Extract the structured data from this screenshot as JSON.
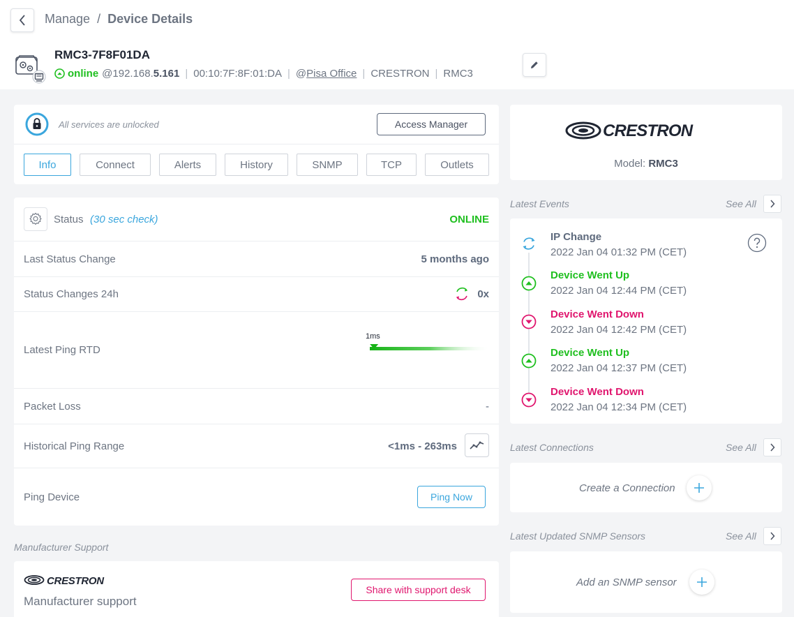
{
  "breadcrumb": {
    "parent": "Manage",
    "separator": "/",
    "current": "Device Details"
  },
  "device": {
    "name": "RMC3-7F8F01DA",
    "status": "online",
    "ip_prefix": "@192.168.",
    "ip_bold": "5.161",
    "mac": "00:10:7F:8F:01:DA",
    "location_prefix": "@",
    "location": "Pisa Office",
    "vendor": "CRESTRON",
    "model": "RMC3"
  },
  "access": {
    "text": "All services are unlocked",
    "button": "Access Manager"
  },
  "tabs": [
    "Info",
    "Connect",
    "Alerts",
    "History",
    "SNMP",
    "TCP",
    "Outlets"
  ],
  "status": {
    "label": "Status",
    "check": "(30 sec check)",
    "value": "ONLINE",
    "last_change_label": "Last Status Change",
    "last_change_value": "5 months ago",
    "changes_label": "Status Changes 24h",
    "changes_value": "0x",
    "ping_label": "Latest Ping RTD",
    "ping_value": "1ms",
    "ping_fraction": 0.02,
    "loss_label": "Packet Loss",
    "loss_value": "-",
    "range_label": "Historical Ping Range",
    "range_value": "<1ms - 263ms",
    "ping_device_label": "Ping Device",
    "ping_now": "Ping Now"
  },
  "manufacturer": {
    "section": "Manufacturer Support",
    "logo": "CRESTRON",
    "text": "Manufacturer support",
    "share": "Share with support desk"
  },
  "vendor_card": {
    "logo": "CRESTRON",
    "model_label": "Model:",
    "model": "RMC3"
  },
  "events": {
    "title": "Latest Events",
    "see_all": "See All",
    "items": [
      {
        "title": "IP Change",
        "time": "2022 Jan 04 01:32 PM (CET)",
        "type": "ip-change"
      },
      {
        "title": "Device Went Up",
        "time": "2022 Jan 04 12:44 PM (CET)",
        "type": "up"
      },
      {
        "title": "Device Went Down",
        "time": "2022 Jan 04 12:42 PM (CET)",
        "type": "down"
      },
      {
        "title": "Device Went Up",
        "time": "2022 Jan 04 12:37 PM (CET)",
        "type": "up"
      },
      {
        "title": "Device Went Down",
        "time": "2022 Jan 04 12:34 PM (CET)",
        "type": "down"
      }
    ]
  },
  "connections": {
    "title": "Latest Connections",
    "see_all": "See All",
    "create": "Create a Connection"
  },
  "snmp": {
    "title": "Latest Updated SNMP Sensors",
    "see_all": "See All",
    "add": "Add an SNMP sensor"
  },
  "colors": {
    "online": "#1fbf1f",
    "down": "#e0166e",
    "accent": "#3aa6dd",
    "share": "#e0166e"
  }
}
